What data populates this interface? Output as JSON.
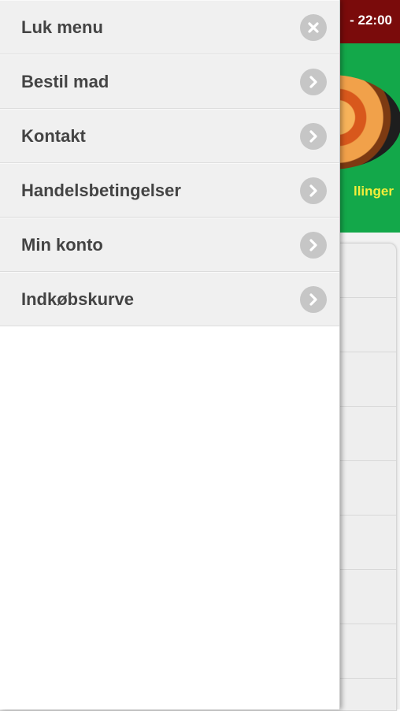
{
  "background": {
    "hours_text": "- 22:00",
    "orders_text": "llinger",
    "colors": {
      "topbar": "#7a0b0b",
      "banner": "#13a84a",
      "orders_text": "#f4ee3a"
    }
  },
  "menu": {
    "items": [
      {
        "label": "Luk menu",
        "icon": "close-icon"
      },
      {
        "label": "Bestil mad",
        "icon": "chevron-right-icon"
      },
      {
        "label": "Kontakt",
        "icon": "chevron-right-icon"
      },
      {
        "label": "Handelsbetingelser",
        "icon": "chevron-right-icon"
      },
      {
        "label": "Min konto",
        "icon": "chevron-right-icon"
      },
      {
        "label": "Indkøbskurve",
        "icon": "chevron-right-icon"
      }
    ]
  }
}
